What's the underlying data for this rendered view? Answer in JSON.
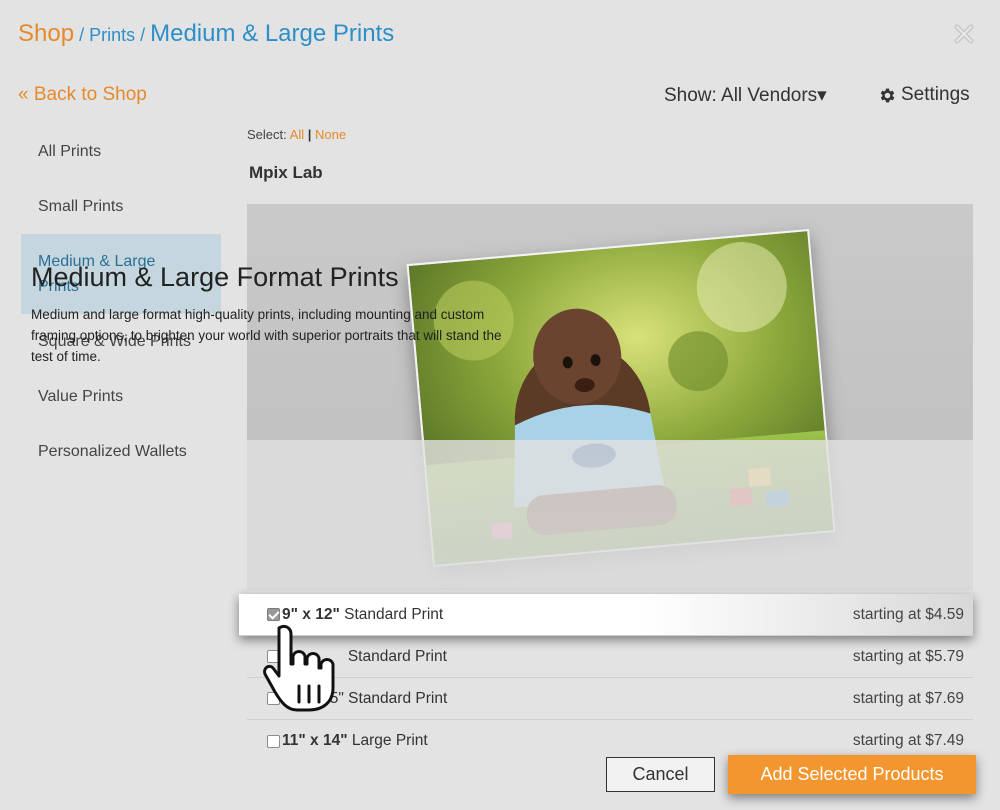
{
  "breadcrumb": {
    "shop": "Shop",
    "sep1": " / ",
    "prints": "Prints",
    "sep2": " / ",
    "current": "Medium & Large Prints"
  },
  "back_link": "« Back to Shop",
  "vendor_filter": {
    "label": "Show: All Vendors▾"
  },
  "settings_label": "Settings",
  "sidebar": {
    "items": [
      {
        "label": "All Prints"
      },
      {
        "label": "Small Prints"
      },
      {
        "label": "Medium & Large Prints"
      },
      {
        "label": "Square & Wide Prints"
      },
      {
        "label": "Value Prints"
      },
      {
        "label": "Personalized Wallets"
      }
    ],
    "active_index": 2
  },
  "select": {
    "prefix": "Select:",
    "all": "All",
    "divider": "|",
    "none": "None"
  },
  "vendor_title": "Mpix Lab",
  "banner": {
    "title": "Medium & Large Format Prints",
    "description": "Medium and large format high-quality prints, including mounting and custom framing options, to brighten your world with superior portraits that will stand the test of time."
  },
  "products": [
    {
      "size": "9\" x 12\"",
      "name": "Standard Print",
      "price": "starting at $4.59",
      "checked": true
    },
    {
      "size": "…",
      "name": "Standard Print",
      "price": "starting at $5.79",
      "checked": false
    },
    {
      "size": "10\" x 15\"",
      "name": "Standard Print",
      "price": "starting at $7.69",
      "checked": false
    },
    {
      "size": "11\" x 14\"",
      "name": "Large Print",
      "price": "starting at $7.49",
      "checked": true
    }
  ],
  "buttons": {
    "cancel": "Cancel",
    "add": "Add Selected Products"
  },
  "colors": {
    "accent": "#e58a2a",
    "link": "#2d8fc8",
    "button": "#f4962f",
    "active_bg": "#c5d6df"
  }
}
